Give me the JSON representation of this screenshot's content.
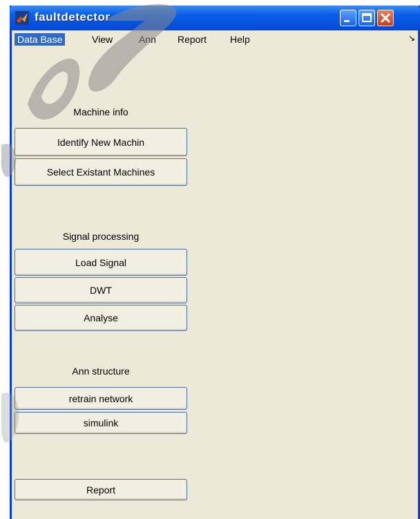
{
  "window": {
    "title": "faultdetector"
  },
  "menu": {
    "items": [
      "Data Base",
      "View",
      "Ann",
      "Report",
      "Help"
    ],
    "dock_glyph": "↘"
  },
  "sections": {
    "machine_info": {
      "label": "Machine info",
      "buttons": [
        "Identify New Machin",
        "Select Existant Machines"
      ]
    },
    "signal_processing": {
      "label": "Signal processing",
      "buttons": [
        "Load Signal",
        "DWT",
        "Analyse"
      ]
    },
    "ann_structure": {
      "label": "Ann structure",
      "buttons": [
        "retrain network",
        "simulink"
      ]
    },
    "report": {
      "button": "Report"
    }
  },
  "colors": {
    "titlebar": "#0a5fe8",
    "window_bg": "#ece9d8",
    "border": "#0a3fd6",
    "menu_highlight": "#316ac5",
    "close_button": "#d9532c"
  }
}
